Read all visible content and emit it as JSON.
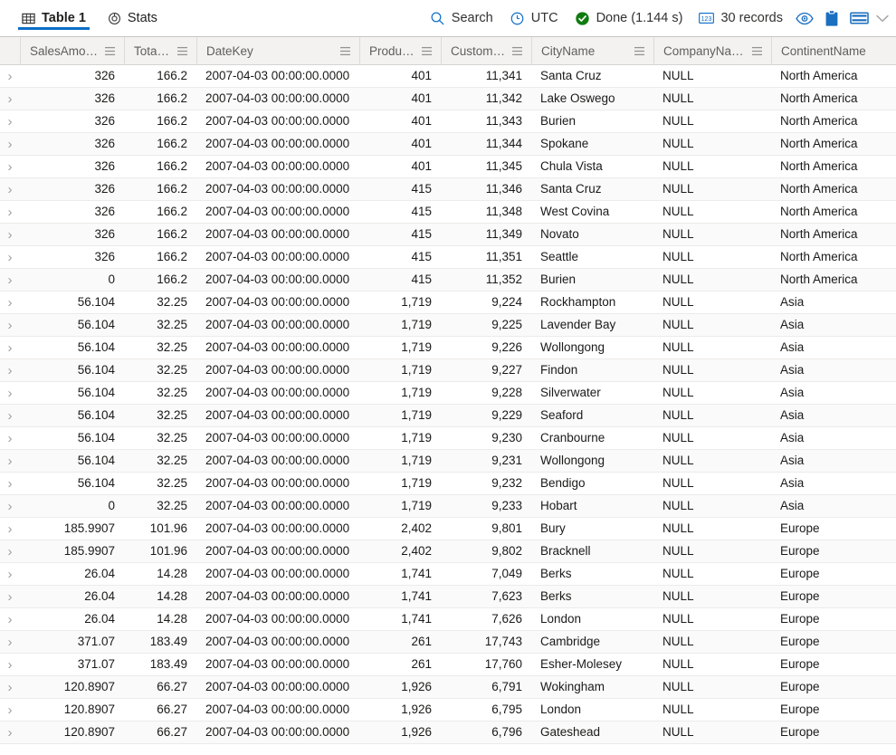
{
  "theme": {
    "accent": "#0b6ec7",
    "success": "#107c10"
  },
  "tabs": [
    {
      "id": "table1",
      "label": "Table 1",
      "icon": "table-icon",
      "active": true
    },
    {
      "id": "stats",
      "label": "Stats",
      "icon": "donut-chart-icon",
      "active": false
    }
  ],
  "toolbar": {
    "search_label": "Search",
    "search_icon": "search-icon",
    "timezone_label": "UTC",
    "timezone_icon": "clock-icon",
    "status_label": "Done (1.144 s)",
    "status_icon": "check-circle-icon",
    "records_label": "30 records",
    "records_icon": "numbers-123-icon",
    "eye_icon": "eye-icon",
    "clipboard_icon": "clipboard-icon",
    "layout_icon": "table-layout-icon",
    "chevron_icon": "chevron-down-icon"
  },
  "grid": {
    "columns": [
      {
        "key": "SalesAmount",
        "label": "SalesAmount",
        "align": "num",
        "menu": true,
        "width": "c1"
      },
      {
        "key": "TotalCost",
        "label": "TotalCost",
        "align": "num",
        "menu": true,
        "width": "c2"
      },
      {
        "key": "DateKey",
        "label": "DateKey",
        "align": "txt",
        "menu": true,
        "width": "c3"
      },
      {
        "key": "ProductKey",
        "label": "ProductKey",
        "align": "num",
        "menu": true,
        "width": "c4"
      },
      {
        "key": "CustomerKey",
        "label": "CustomerKey",
        "align": "num",
        "menu": true,
        "width": "c5"
      },
      {
        "key": "CityName",
        "label": "CityName",
        "align": "txt",
        "menu": true,
        "width": "c6"
      },
      {
        "key": "CompanyName",
        "label": "CompanyName",
        "align": "txt",
        "menu": true,
        "width": "c7"
      },
      {
        "key": "ContinentName",
        "label": "ContinentName",
        "align": "txt",
        "menu": false,
        "width": "c8"
      }
    ],
    "expander_glyph": "›",
    "rows": [
      [
        "326",
        "166.2",
        "2007-04-03 00:00:00.0000",
        "401",
        "11,341",
        "Santa Cruz",
        "NULL",
        "North America"
      ],
      [
        "326",
        "166.2",
        "2007-04-03 00:00:00.0000",
        "401",
        "11,342",
        "Lake Oswego",
        "NULL",
        "North America"
      ],
      [
        "326",
        "166.2",
        "2007-04-03 00:00:00.0000",
        "401",
        "11,343",
        "Burien",
        "NULL",
        "North America"
      ],
      [
        "326",
        "166.2",
        "2007-04-03 00:00:00.0000",
        "401",
        "11,344",
        "Spokane",
        "NULL",
        "North America"
      ],
      [
        "326",
        "166.2",
        "2007-04-03 00:00:00.0000",
        "401",
        "11,345",
        "Chula Vista",
        "NULL",
        "North America"
      ],
      [
        "326",
        "166.2",
        "2007-04-03 00:00:00.0000",
        "415",
        "11,346",
        "Santa Cruz",
        "NULL",
        "North America"
      ],
      [
        "326",
        "166.2",
        "2007-04-03 00:00:00.0000",
        "415",
        "11,348",
        "West Covina",
        "NULL",
        "North America"
      ],
      [
        "326",
        "166.2",
        "2007-04-03 00:00:00.0000",
        "415",
        "11,349",
        "Novato",
        "NULL",
        "North America"
      ],
      [
        "326",
        "166.2",
        "2007-04-03 00:00:00.0000",
        "415",
        "11,351",
        "Seattle",
        "NULL",
        "North America"
      ],
      [
        "0",
        "166.2",
        "2007-04-03 00:00:00.0000",
        "415",
        "11,352",
        "Burien",
        "NULL",
        "North America"
      ],
      [
        "56.104",
        "32.25",
        "2007-04-03 00:00:00.0000",
        "1,719",
        "9,224",
        "Rockhampton",
        "NULL",
        "Asia"
      ],
      [
        "56.104",
        "32.25",
        "2007-04-03 00:00:00.0000",
        "1,719",
        "9,225",
        "Lavender Bay",
        "NULL",
        "Asia"
      ],
      [
        "56.104",
        "32.25",
        "2007-04-03 00:00:00.0000",
        "1,719",
        "9,226",
        "Wollongong",
        "NULL",
        "Asia"
      ],
      [
        "56.104",
        "32.25",
        "2007-04-03 00:00:00.0000",
        "1,719",
        "9,227",
        "Findon",
        "NULL",
        "Asia"
      ],
      [
        "56.104",
        "32.25",
        "2007-04-03 00:00:00.0000",
        "1,719",
        "9,228",
        "Silverwater",
        "NULL",
        "Asia"
      ],
      [
        "56.104",
        "32.25",
        "2007-04-03 00:00:00.0000",
        "1,719",
        "9,229",
        "Seaford",
        "NULL",
        "Asia"
      ],
      [
        "56.104",
        "32.25",
        "2007-04-03 00:00:00.0000",
        "1,719",
        "9,230",
        "Cranbourne",
        "NULL",
        "Asia"
      ],
      [
        "56.104",
        "32.25",
        "2007-04-03 00:00:00.0000",
        "1,719",
        "9,231",
        "Wollongong",
        "NULL",
        "Asia"
      ],
      [
        "56.104",
        "32.25",
        "2007-04-03 00:00:00.0000",
        "1,719",
        "9,232",
        "Bendigo",
        "NULL",
        "Asia"
      ],
      [
        "0",
        "32.25",
        "2007-04-03 00:00:00.0000",
        "1,719",
        "9,233",
        "Hobart",
        "NULL",
        "Asia"
      ],
      [
        "185.9907",
        "101.96",
        "2007-04-03 00:00:00.0000",
        "2,402",
        "9,801",
        "Bury",
        "NULL",
        "Europe"
      ],
      [
        "185.9907",
        "101.96",
        "2007-04-03 00:00:00.0000",
        "2,402",
        "9,802",
        "Bracknell",
        "NULL",
        "Europe"
      ],
      [
        "26.04",
        "14.28",
        "2007-04-03 00:00:00.0000",
        "1,741",
        "7,049",
        "Berks",
        "NULL",
        "Europe"
      ],
      [
        "26.04",
        "14.28",
        "2007-04-03 00:00:00.0000",
        "1,741",
        "7,623",
        "Berks",
        "NULL",
        "Europe"
      ],
      [
        "26.04",
        "14.28",
        "2007-04-03 00:00:00.0000",
        "1,741",
        "7,626",
        "London",
        "NULL",
        "Europe"
      ],
      [
        "371.07",
        "183.49",
        "2007-04-03 00:00:00.0000",
        "261",
        "17,743",
        "Cambridge",
        "NULL",
        "Europe"
      ],
      [
        "371.07",
        "183.49",
        "2007-04-03 00:00:00.0000",
        "261",
        "17,760",
        "Esher-Molesey",
        "NULL",
        "Europe"
      ],
      [
        "120.8907",
        "66.27",
        "2007-04-03 00:00:00.0000",
        "1,926",
        "6,791",
        "Wokingham",
        "NULL",
        "Europe"
      ],
      [
        "120.8907",
        "66.27",
        "2007-04-03 00:00:00.0000",
        "1,926",
        "6,795",
        "London",
        "NULL",
        "Europe"
      ],
      [
        "120.8907",
        "66.27",
        "2007-04-03 00:00:00.0000",
        "1,926",
        "6,796",
        "Gateshead",
        "NULL",
        "Europe"
      ]
    ]
  }
}
